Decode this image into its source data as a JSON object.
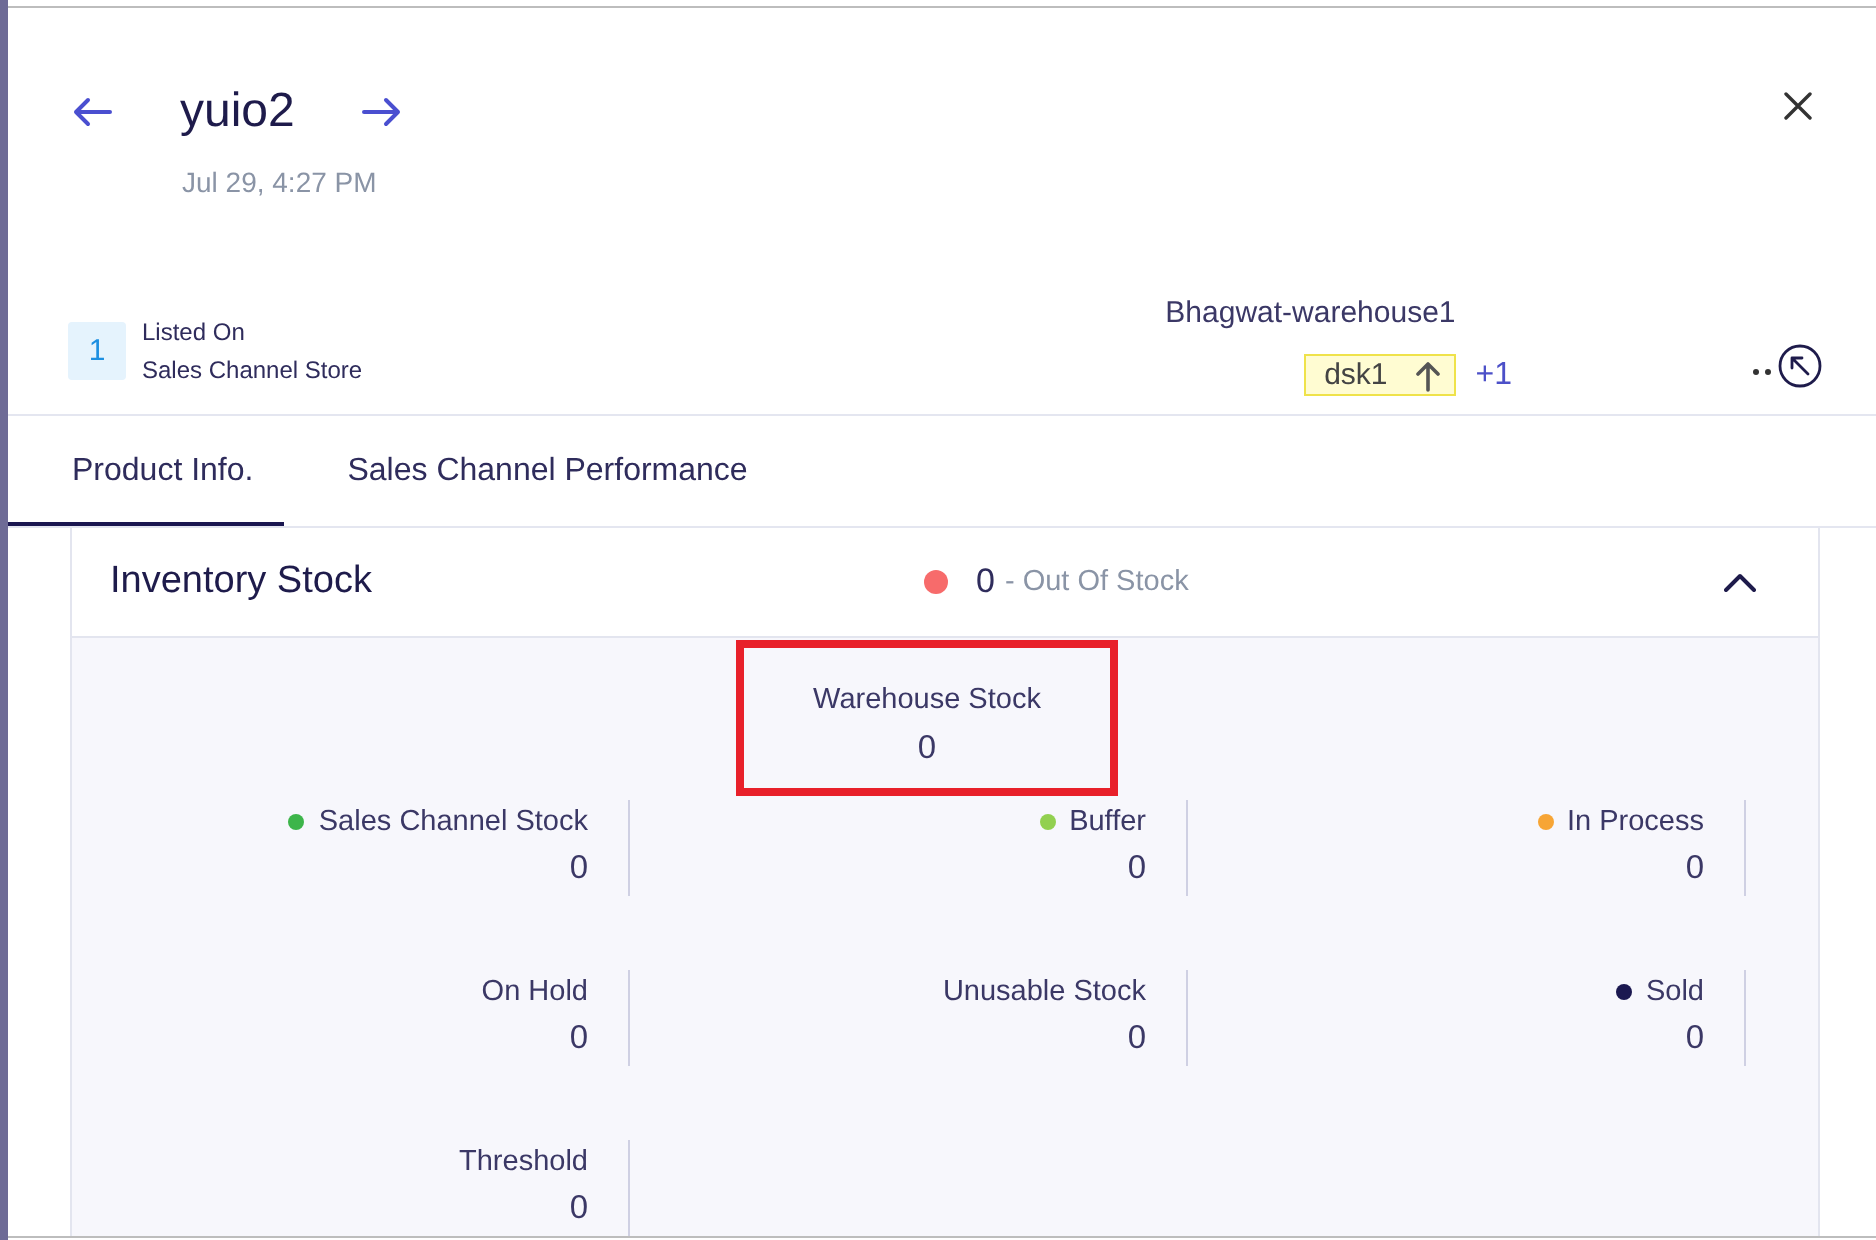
{
  "header": {
    "title": "yuio2",
    "date": "Jul 29, 4:27 PM"
  },
  "listing": {
    "count": "1",
    "label": "Listed On",
    "channel": "Sales Channel Store"
  },
  "warehouse": {
    "name": "Bhagwat-warehouse1",
    "tag": "dsk1",
    "more": "+1"
  },
  "tabs": [
    {
      "label": "Product Info.",
      "selected": true
    },
    {
      "label": "Sales Channel Performance",
      "selected": false
    }
  ],
  "inventory": {
    "title": "Inventory Stock",
    "expanded": true,
    "status": {
      "kind": "out_of_stock",
      "count": "0",
      "label": "- Out Of Stock"
    },
    "featured": {
      "label": "Warehouse Stock",
      "value": "0",
      "highlighted": true
    },
    "metrics": [
      {
        "label": "Sales Channel Stock",
        "value": "0",
        "color": "#3db54a"
      },
      {
        "label": "Buffer",
        "value": "0",
        "color": "#92d050"
      },
      {
        "label": "In Process",
        "value": "0",
        "color": "#f7a535"
      },
      {
        "label": "On Hold",
        "value": "0"
      },
      {
        "label": "Unusable Stock",
        "value": "0"
      },
      {
        "label": "Sold",
        "value": "0",
        "color": "#1b1850"
      },
      {
        "label": "Threshold",
        "value": "0"
      }
    ]
  }
}
